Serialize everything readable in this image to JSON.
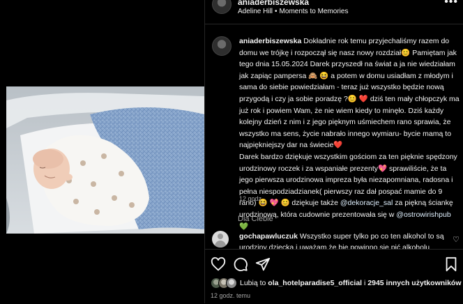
{
  "post": {
    "username": "aniaderbiszewska",
    "music_artist": "Adeline Hill",
    "music_track": "Moments to Memories",
    "separator": "•"
  },
  "caption": {
    "username": "aniaderbiszewska",
    "p1": " Dokładnie rok temu przyjechaliśmy razem do domu we trójkę i rozpoczął się nasz nowy rozdział",
    "e1": "😊",
    "p2": " Pamiętam jak tego dnia 15.05.2024 Darek przyszedł na świat a ja nie wiedziałam jak zapiąc pampersa",
    "e2": "🙈 😆",
    "p3": " a potem w domu usiadłam z młodym i sama do siebie powiedziałam - teraz już wszystko będzie nową przygodą i czy ja sobie poradzę ?",
    "e3": "😊",
    "e4": "❤️",
    "p4": " dziś ten mały chłopczyk ma już rok i powiem Wam, że nie wiem kiedy to minęło. Dziś każdy kolejny dzień z nim i z jego pięknym uśmiechem rano sprawia, że wszystko ma sens, życie nabrało innego wymiaru- bycie mamą to najpiękniejszy dar na świecie",
    "e5": "❤️",
    "p5": "Darek bardzo dziękuje wszystkim gościom za ten pięknie spędzony urodzinowy roczek i za wspaniałe prezenty",
    "e6": "💖",
    "p6": " sprawiliście, że ta jego pierwsza urodzinowa impreza była niezapomniana, radosna i pełna niespodziadzianek( pierwszy raz dał pospać mamie do 9 rano)",
    "e7": "😆",
    "e8": "💖",
    "e9": "😊",
    "p7": " dziękuje także ",
    "mention1": "@dekoracje_sal",
    "p8": " za piękną ściankę urodzinową, która cudownie prezentowała się w ",
    "mention2": "@ostrowirishpub",
    "e10": "💚",
    "time": "12 godz."
  },
  "for_you": "Dla Ciebie",
  "comment": {
    "username": "gochapawluczuk",
    "text": " Wszystko super tylko po co ten alkohol to są urodziny dziecka i uważam że bie powinno się pić alkoholu"
  },
  "icons": {
    "more": "more-horizontal-icon",
    "like": "heart-icon",
    "comment": "comment-icon",
    "share": "share-icon",
    "save": "bookmark-icon"
  },
  "likes": {
    "prefix": "Lubią to ",
    "user": "ola_hotelparadise5_official",
    "middle": " i ",
    "others": "2945 innych użytkowników"
  },
  "footer_time": "12 godz. temu",
  "colors": {
    "background": "#000000",
    "text": "#f5f5f5",
    "muted": "#a8a8a8",
    "link": "#e0f1ff",
    "heart": "#ed4956"
  }
}
